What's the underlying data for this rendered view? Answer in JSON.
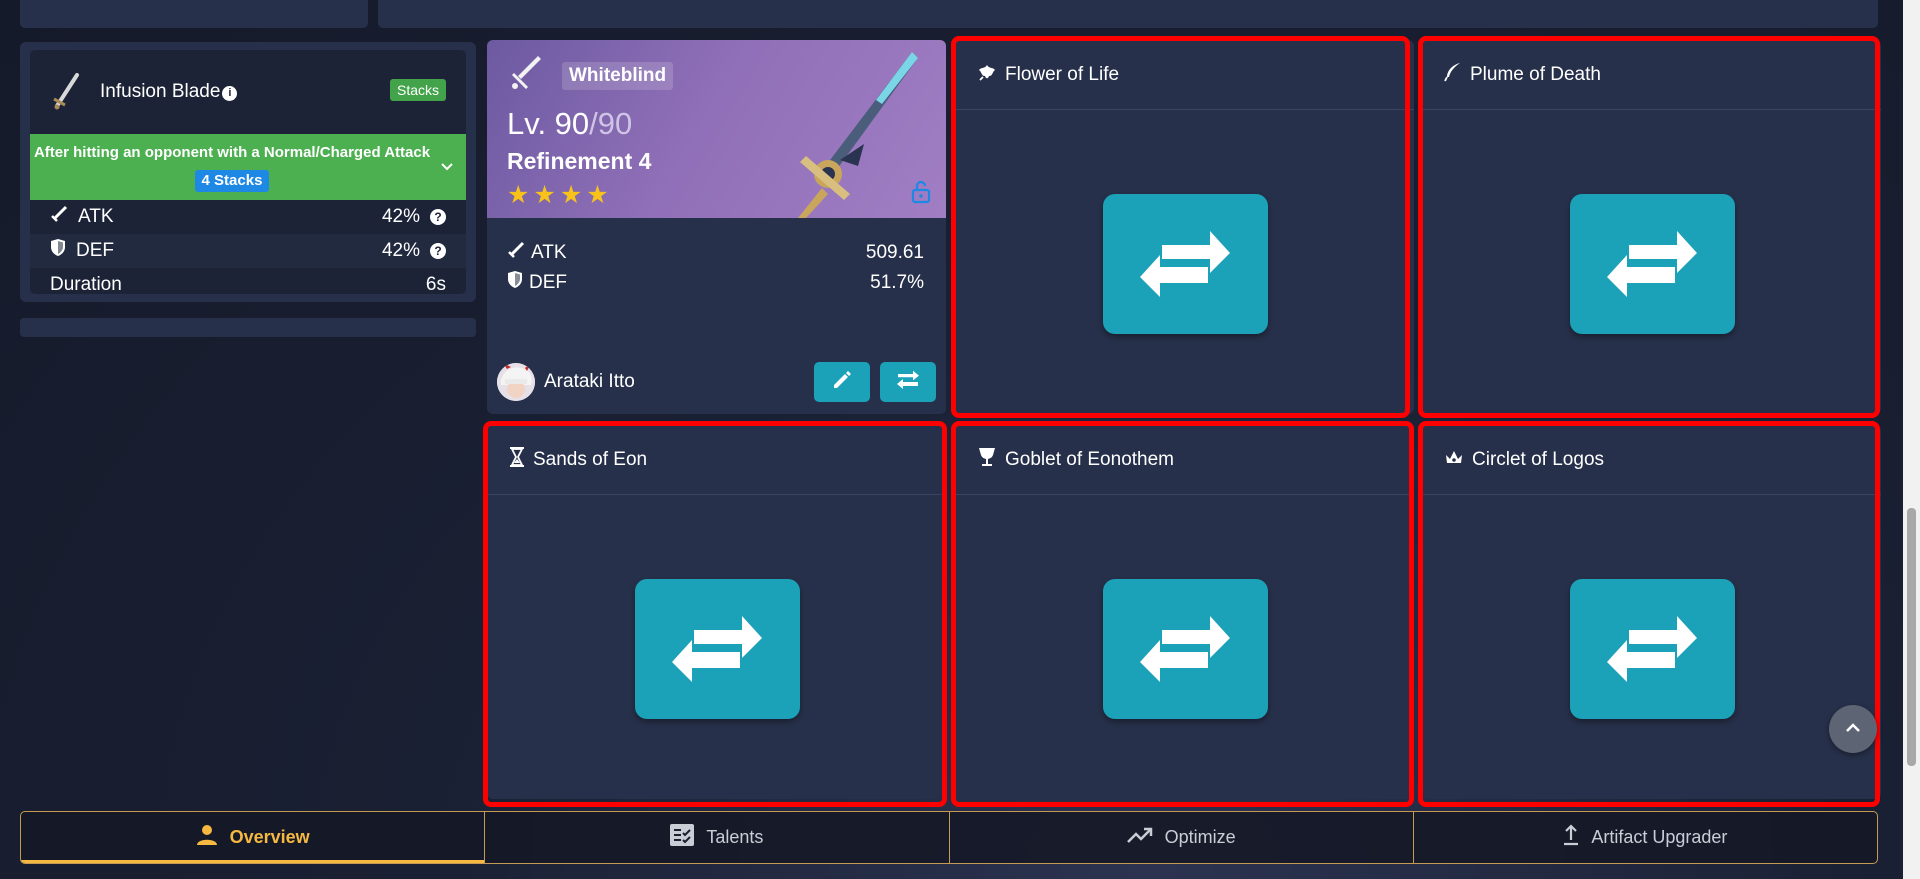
{
  "passive": {
    "title": "Infusion Blade",
    "badge": "Stacks",
    "condition_text": "After hitting an opponent with a Normal/Charged Attack",
    "condition_badge": "4 Stacks",
    "stats": [
      {
        "label": "ATK",
        "value": "42%"
      },
      {
        "label": "DEF",
        "value": "42%"
      },
      {
        "label": "Duration",
        "value": "6s"
      }
    ]
  },
  "weapon": {
    "name": "Whiteblind",
    "level_prefix": "Lv. 90",
    "level_max": "/90",
    "refinement": "Refinement 4",
    "stars": "★★★★",
    "stats": [
      {
        "label": "ATK",
        "value": "509.61"
      },
      {
        "label": "DEF",
        "value": "51.7%"
      }
    ],
    "character": "Arataki Itto"
  },
  "slots": [
    {
      "label": "Flower of Life",
      "icon": "flower-icon"
    },
    {
      "label": "Plume of Death",
      "icon": "plume-icon"
    },
    {
      "label": "Sands of Eon",
      "icon": "hourglass-icon"
    },
    {
      "label": "Goblet of Eonothem",
      "icon": "goblet-icon"
    },
    {
      "label": "Circlet of Logos",
      "icon": "circlet-icon"
    }
  ],
  "tabs": [
    {
      "label": "Overview",
      "icon": "person-icon",
      "active": true
    },
    {
      "label": "Talents",
      "icon": "checklist-icon",
      "active": false
    },
    {
      "label": "Optimize",
      "icon": "trending-up-icon",
      "active": false
    },
    {
      "label": "Artifact Upgrader",
      "icon": "upload-icon",
      "active": false
    }
  ],
  "colors": {
    "accent": "#1ba1b8",
    "tab_active": "#f5b840",
    "highlight_outline": "#ff0000",
    "condition_green": "#4caf50"
  }
}
